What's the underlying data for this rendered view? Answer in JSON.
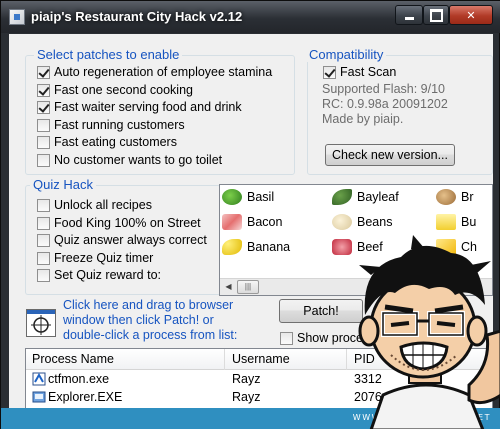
{
  "window": {
    "title": "piaip's Restaurant City Hack v2.12",
    "accent": "#1654c0",
    "banner_text": "WWW.LEMONGRAPHIC.NET"
  },
  "patches": {
    "legend": "Select patches to enable",
    "items": [
      {
        "label": "Auto regeneration of employee stamina",
        "checked": true
      },
      {
        "label": "Fast one second cooking",
        "checked": true
      },
      {
        "label": "Fast waiter serving food and drink",
        "checked": true
      },
      {
        "label": "Fast running customers",
        "checked": false
      },
      {
        "label": "Fast eating customers",
        "checked": false
      },
      {
        "label": "No customer wants to go toilet",
        "checked": false
      }
    ]
  },
  "compat": {
    "legend": "Compatibility",
    "fast_scan": "Fast Scan",
    "fast_scan_checked": true,
    "supported": "Supported Flash: 9/10",
    "rc": "RC: 0.9.98a 20091202",
    "made_by": "Made by piaip.",
    "check_button": "Check new version..."
  },
  "quiz": {
    "legend": "Quiz Hack",
    "items": [
      {
        "label": "Unlock all recipes",
        "checked": false
      },
      {
        "label": "Food King 100% on Street",
        "checked": false
      },
      {
        "label": "Quiz answer always correct",
        "checked": false
      },
      {
        "label": "Freeze Quiz timer",
        "checked": false
      },
      {
        "label": "Set Quiz reward to:",
        "checked": false
      }
    ]
  },
  "recipes": {
    "col1": [
      "Basil",
      "Bacon",
      "Banana"
    ],
    "col2": [
      "Bayleaf",
      "Beans",
      "Beef"
    ],
    "col3": [
      "Br",
      "Bu",
      "Ch"
    ]
  },
  "drag": {
    "line1": "Click here and drag to browser",
    "line2": "window then click Patch! or",
    "line3": "double-click a process from list:"
  },
  "patch_button": "Patch!",
  "show_process": "Show process",
  "processes": {
    "headers": [
      "Process Name",
      "Username",
      "PID"
    ],
    "rows": [
      {
        "name": "ctfmon.exe",
        "user": "Rayz",
        "pid": "3312"
      },
      {
        "name": "Explorer.EXE",
        "user": "Rayz",
        "pid": "2076"
      }
    ]
  }
}
